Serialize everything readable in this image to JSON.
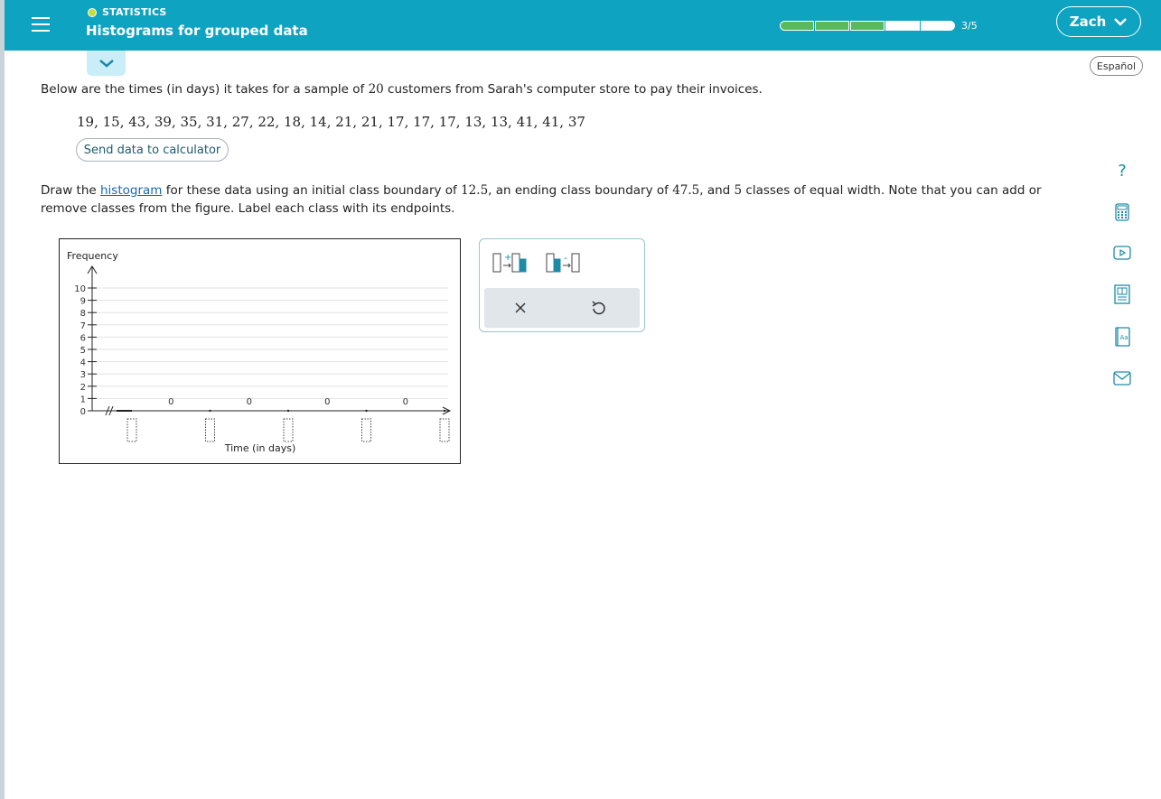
{
  "header": {
    "topic": "STATISTICS",
    "title": "Histograms for grouped data",
    "progress_text": "3/5",
    "progress_done": 3,
    "progress_total": 5,
    "user_name": "Zach",
    "accent_color": "#0ea3c1",
    "progress_color": "#5cb85c"
  },
  "language_button": "Español",
  "question": {
    "intro_before": "Below are the times (in days) it takes for a sample of ",
    "sample_size": "20",
    "intro_after": " customers from Sarah's computer store to pay their invoices.",
    "data_values": "19, 15, 43, 39, 35, 31, 27, 22, 18, 14, 21, 21, 17, 17, 17, 13, 13, 41, 41, 37",
    "send_button": "Send data to calculator",
    "instr_1": "Draw the ",
    "instr_link": "histogram",
    "instr_2": " for these data using an initial class boundary of ",
    "initial_boundary": "12.5",
    "instr_3": ", an ending class boundary of ",
    "ending_boundary": "47.5",
    "instr_4": ", and ",
    "num_classes": "5",
    "instr_5": " classes of equal width. Note that you can add or remove classes from the figure. Label each class with its endpoints."
  },
  "chart_data": {
    "type": "bar",
    "ylabel": "Frequency",
    "xlabel": "Time (in days)",
    "ylim": [
      0,
      10
    ],
    "yticks": [
      "0",
      "1",
      "2",
      "3",
      "4",
      "5",
      "6",
      "7",
      "8",
      "9",
      "10"
    ],
    "bar_values": [
      "0",
      "0",
      "0",
      "0"
    ],
    "class_labels": [
      "",
      "",
      "",
      "",
      ""
    ],
    "grid": true
  },
  "tools": {
    "add_class": "add-class-icon",
    "remove_class": "remove-class-icon",
    "clear": "clear-icon",
    "undo": "undo-icon"
  },
  "side_tools": [
    "help-icon",
    "calculator-icon",
    "video-icon",
    "textbook-icon",
    "dictionary-icon",
    "message-icon"
  ]
}
